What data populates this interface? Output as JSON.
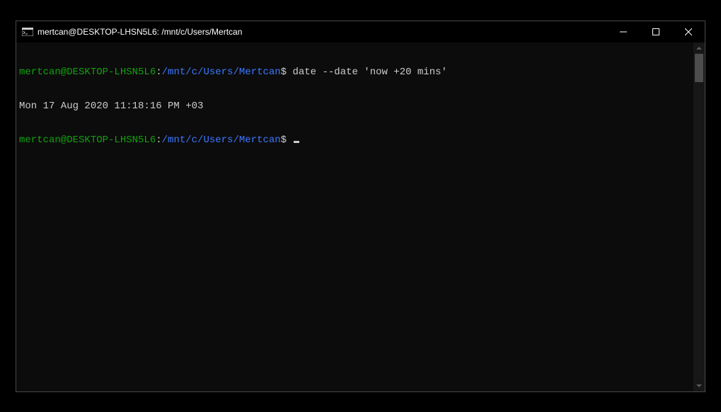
{
  "window": {
    "title": "mertcan@DESKTOP-LHSN5L6: /mnt/c/Users/Mertcan"
  },
  "prompt": {
    "user_host": "mertcan@DESKTOP-LHSN5L6",
    "separator": ":",
    "path": "/mnt/c/Users/Mertcan",
    "symbol": "$"
  },
  "lines": {
    "l0_cmd": " date --date 'now +20 mins'",
    "l1_output": "Mon 17 Aug 2020 11:18:16 PM +03"
  },
  "colors": {
    "user": "#13a10e",
    "path": "#3b78ff",
    "text": "#cccccc",
    "bg": "#0c0c0c"
  }
}
